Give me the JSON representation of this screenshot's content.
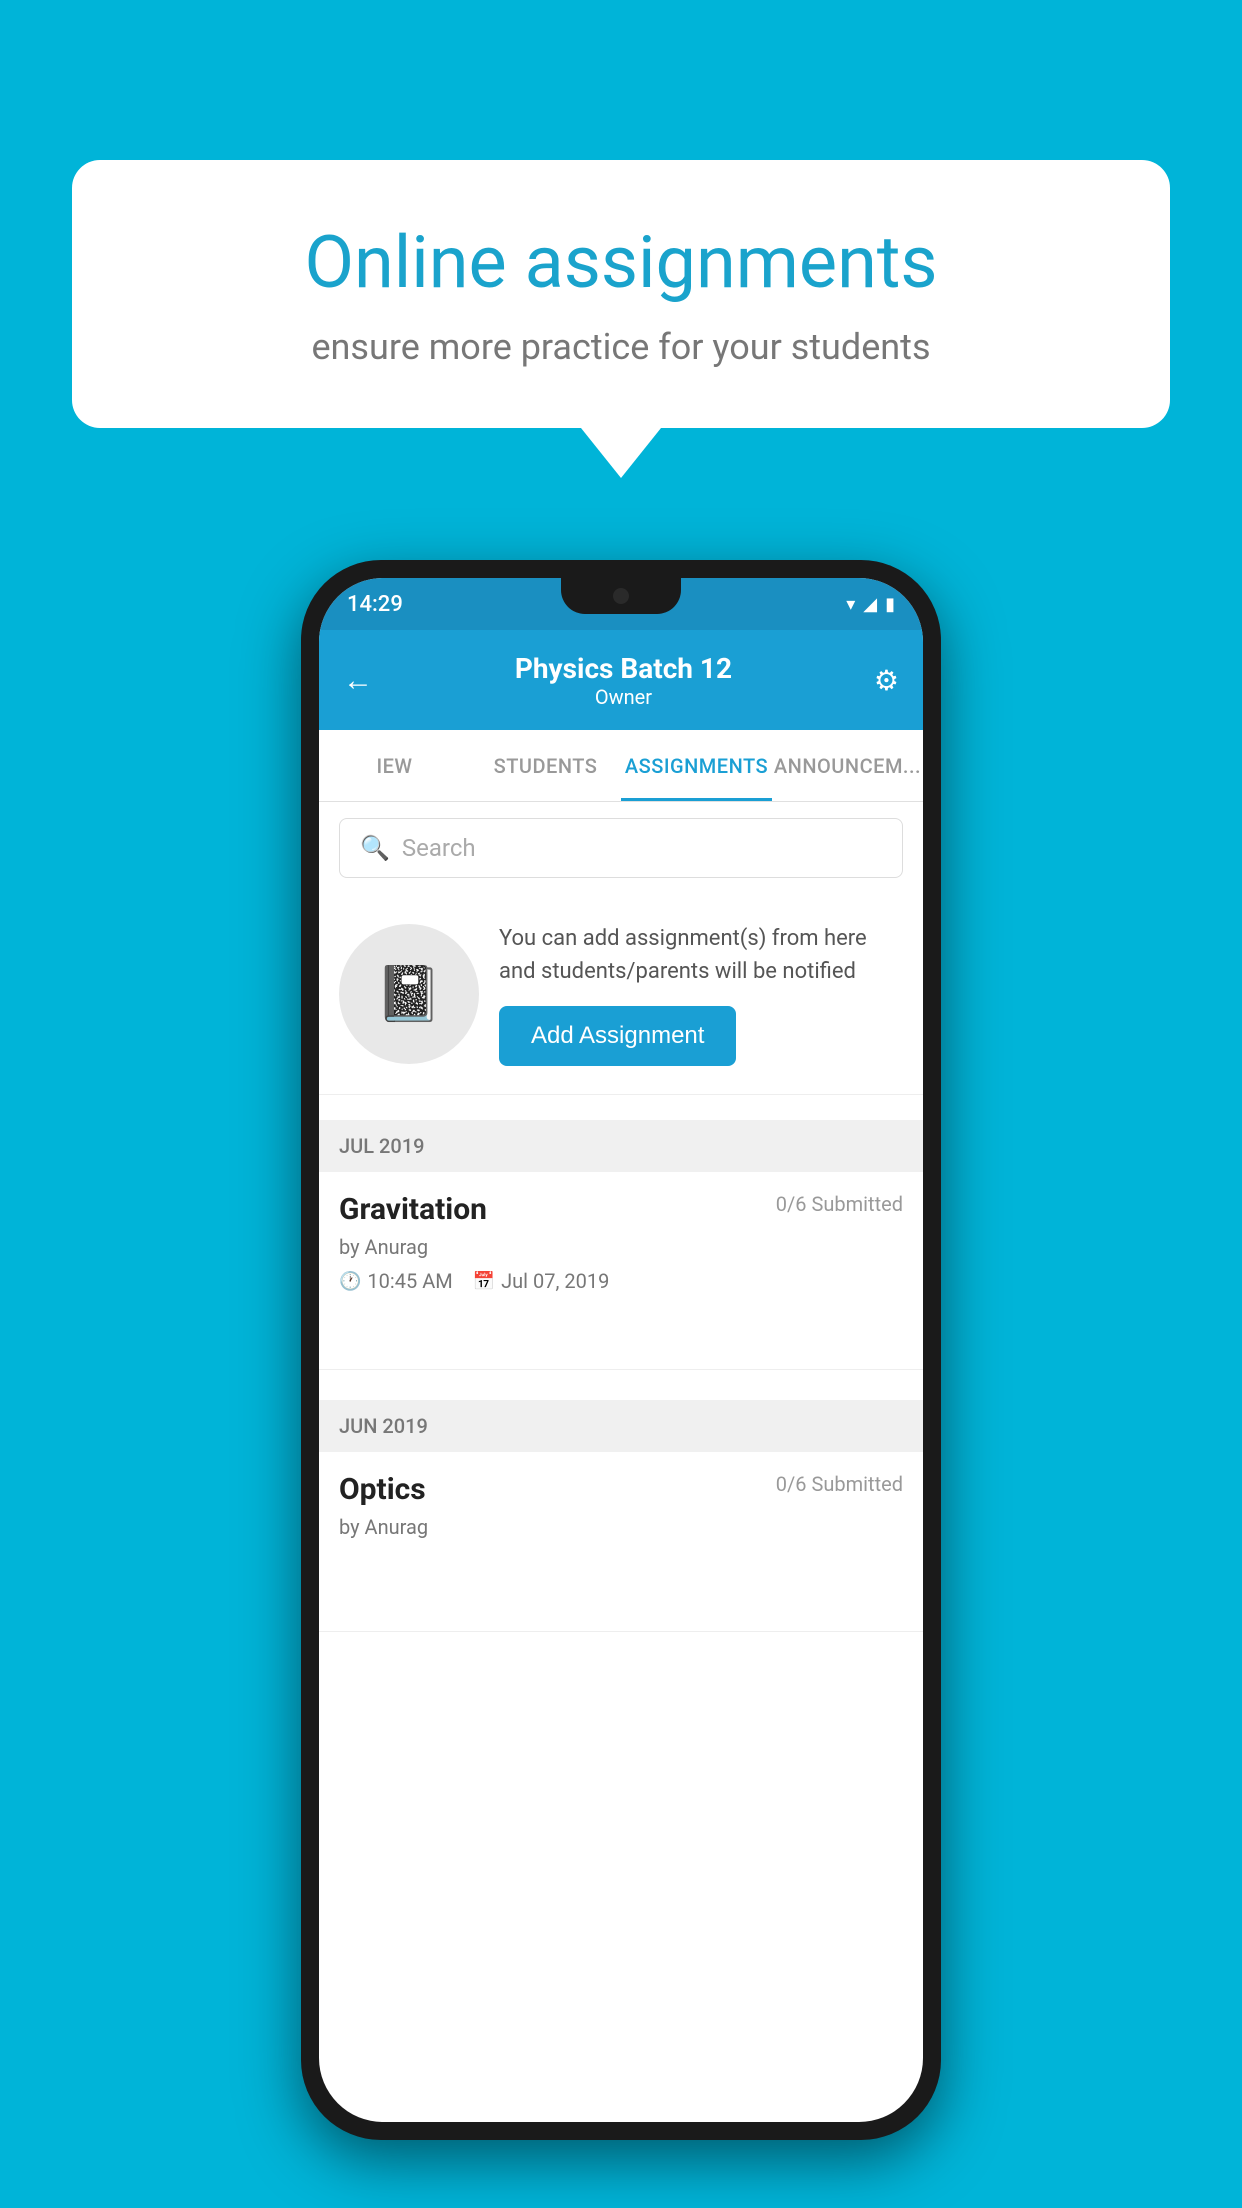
{
  "background": {
    "color": "#00b4d8"
  },
  "speech_bubble": {
    "title": "Online assignments",
    "subtitle": "ensure more practice for your students"
  },
  "phone": {
    "status_bar": {
      "time": "14:29",
      "icons": [
        "wifi",
        "signal",
        "battery"
      ]
    },
    "header": {
      "back_label": "←",
      "title": "Physics Batch 12",
      "subtitle": "Owner",
      "settings_icon": "⚙"
    },
    "tabs": [
      {
        "label": "IEW",
        "active": false
      },
      {
        "label": "STUDENTS",
        "active": false
      },
      {
        "label": "ASSIGNMENTS",
        "active": true
      },
      {
        "label": "ANNOUNCEM...",
        "active": false
      }
    ],
    "search": {
      "placeholder": "Search"
    },
    "promo": {
      "text": "You can add assignment(s) from here and students/parents will be notified",
      "button_label": "Add Assignment"
    },
    "sections": [
      {
        "label": "JUL 2019",
        "assignments": [
          {
            "name": "Gravitation",
            "submitted": "0/6 Submitted",
            "by": "by Anurag",
            "time": "10:45 AM",
            "date": "Jul 07, 2019"
          }
        ]
      },
      {
        "label": "JUN 2019",
        "assignments": [
          {
            "name": "Optics",
            "submitted": "0/6 Submitted",
            "by": "by Anurag"
          }
        ]
      }
    ]
  }
}
